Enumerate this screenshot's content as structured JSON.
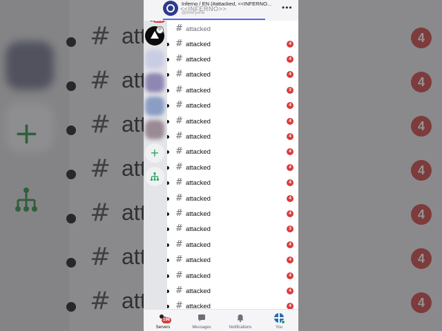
{
  "header": {
    "title": "Inferno / EN (#attacked, <<INFERNO...",
    "subtitle": "<<INFERNO>>",
    "sub_caption": "@everyone"
  },
  "rail": {
    "badge": "196"
  },
  "channels": [
    {
      "name": "attacked",
      "badge": ""
    },
    {
      "name": "attacked",
      "badge": "4"
    },
    {
      "name": "attacked",
      "badge": "4"
    },
    {
      "name": "attacked",
      "badge": "4"
    },
    {
      "name": "attacked",
      "badge": "3"
    },
    {
      "name": "attacked",
      "badge": "4"
    },
    {
      "name": "attacked",
      "badge": "4"
    },
    {
      "name": "attacked",
      "badge": "4"
    },
    {
      "name": "attacked",
      "badge": "4"
    },
    {
      "name": "attacked",
      "badge": "4"
    },
    {
      "name": "attacked",
      "badge": "4"
    },
    {
      "name": "attacked",
      "badge": "4"
    },
    {
      "name": "attacked",
      "badge": "4"
    },
    {
      "name": "attacked",
      "badge": "3"
    },
    {
      "name": "attacked",
      "badge": "4"
    },
    {
      "name": "attacked",
      "badge": "4"
    },
    {
      "name": "attacked",
      "badge": "4"
    },
    {
      "name": "attacked",
      "badge": "4"
    },
    {
      "name": "attacked",
      "badge": "4"
    }
  ],
  "tabs": [
    {
      "label": "Servers",
      "icon": "servers-icon",
      "badge": "196"
    },
    {
      "label": "Messages",
      "icon": "messages-icon"
    },
    {
      "label": "Notifications",
      "icon": "bell-icon"
    },
    {
      "label": "You",
      "icon": "avatar"
    }
  ],
  "background": {
    "word": "attac",
    "badge": "4"
  },
  "colors": {
    "accent": "#5865f2",
    "badge": "#d83c3e",
    "green": "#23a559",
    "server_primary": "#2e3a8c"
  }
}
